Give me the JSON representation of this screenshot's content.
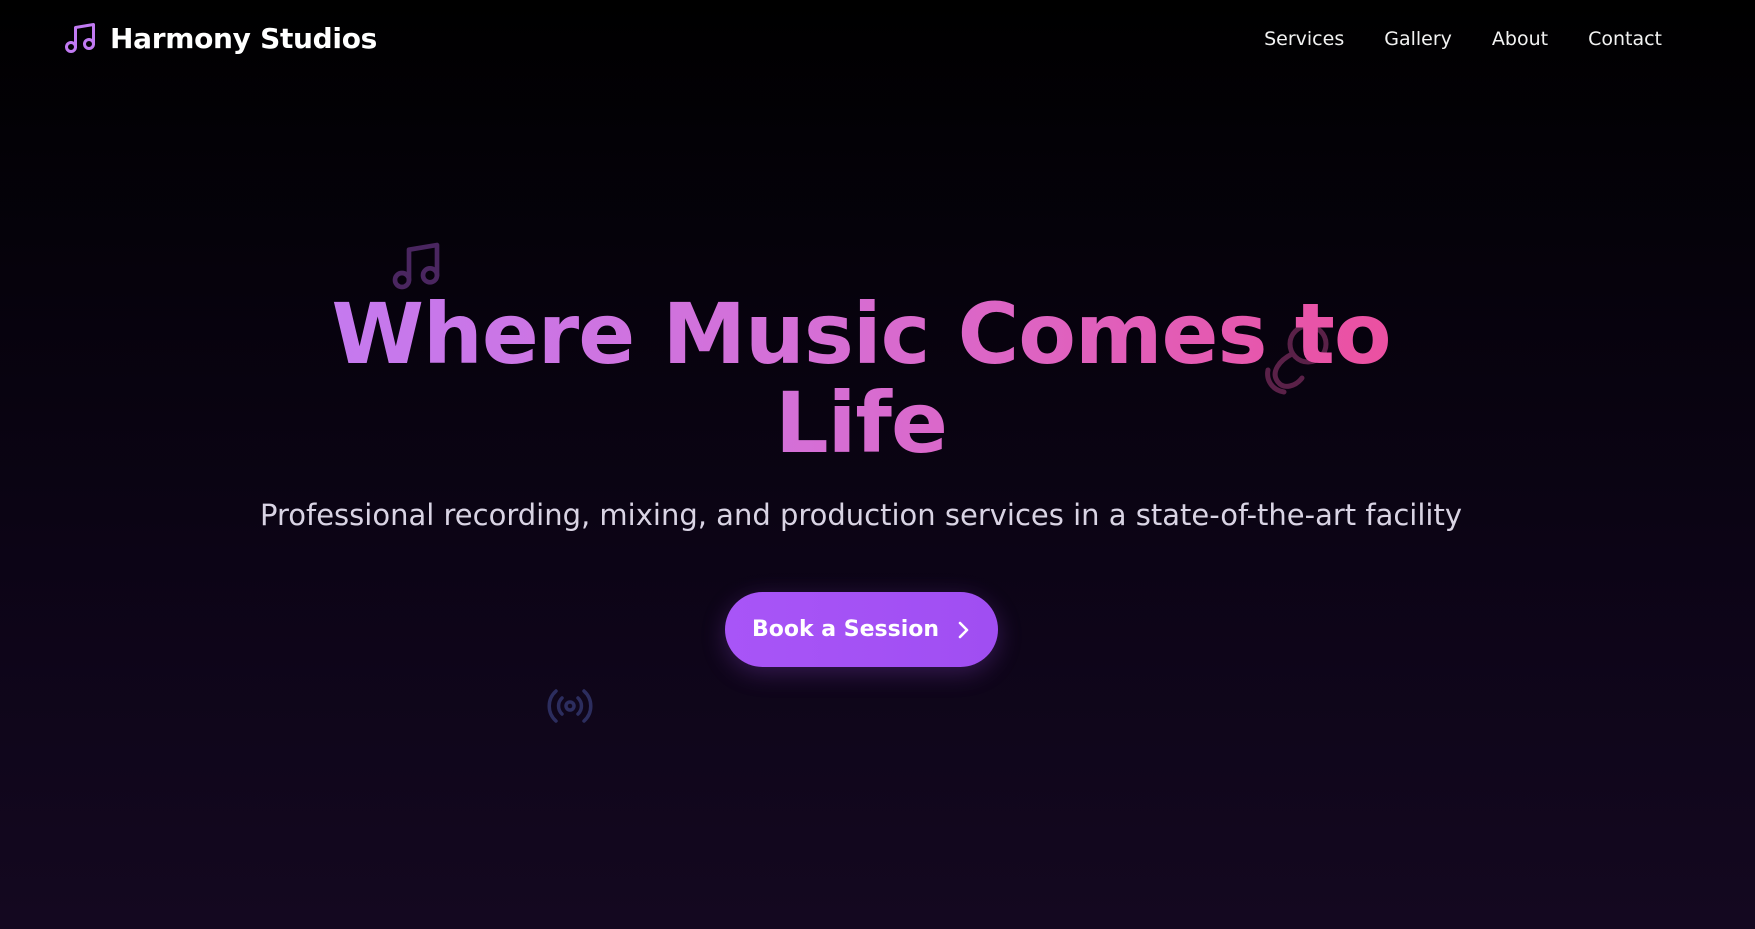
{
  "brand": {
    "name": "Harmony Studios",
    "icon": "music-note-icon"
  },
  "nav": {
    "links": [
      "Services",
      "Gallery",
      "About",
      "Contact"
    ]
  },
  "hero": {
    "title": "Where Music Comes to Life",
    "subtitle": "Professional recording, mixing, and production services in a state-of-the-art facility",
    "cta_label": "Book a Session",
    "cta_icon": "chevron-right-icon"
  },
  "decorations": {
    "icons": [
      "music-note-icon",
      "headphones-icon",
      "radio-broadcast-icon"
    ]
  },
  "colors": {
    "accent": "#a855f7",
    "title_gradient_start": "#c47af0",
    "title_gradient_end": "#ec4f9f",
    "background": "#0e0519"
  }
}
